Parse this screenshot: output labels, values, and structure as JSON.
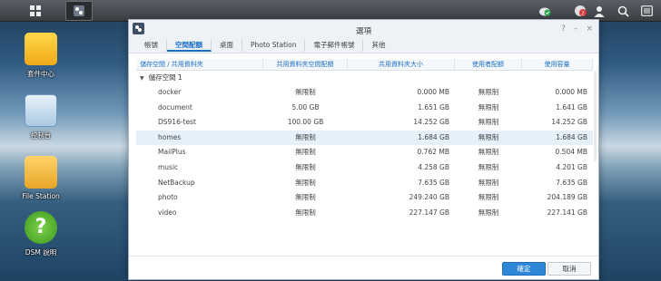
{
  "desktop": {
    "icons": [
      {
        "label": "套件中心"
      },
      {
        "label": "控制台"
      },
      {
        "label": "File Station"
      },
      {
        "label": "DSM 說明"
      }
    ]
  },
  "taskbar": {
    "notification_count": "2"
  },
  "window": {
    "title": "選項",
    "controls": {
      "help": "?",
      "minimize": "–",
      "close": "×"
    },
    "tabs": [
      {
        "label": "帳號"
      },
      {
        "label": "空間配額"
      },
      {
        "label": "桌面"
      },
      {
        "label": "Photo Station"
      },
      {
        "label": "電子郵件帳號"
      },
      {
        "label": "其他"
      }
    ],
    "active_tab": 1,
    "table": {
      "headers": [
        "儲存空間 / 共用資料夾",
        "共用資料夾空間配額",
        "共用資料夾大小",
        "使用者配額",
        "使用容量"
      ],
      "group": "儲存空間 1",
      "rows": [
        [
          "docker",
          "無限制",
          "0.000 MB",
          "無限制",
          "0.000 MB"
        ],
        [
          "document",
          "5.00 GB",
          "1.651 GB",
          "無限制",
          "1.641 GB"
        ],
        [
          "DS916-test",
          "100.00 GB",
          "14.252 GB",
          "無限制",
          "14.252 GB"
        ],
        [
          "homes",
          "無限制",
          "1.684 GB",
          "無限制",
          "1.684 GB"
        ],
        [
          "MailPlus",
          "無限制",
          "0.762 MB",
          "無限制",
          "0.504 MB"
        ],
        [
          "music",
          "無限制",
          "4.258 GB",
          "無限制",
          "4.201 GB"
        ],
        [
          "NetBackup",
          "無限制",
          "7.635 GB",
          "無限制",
          "7.635 GB"
        ],
        [
          "photo",
          "無限制",
          "249.240 GB",
          "無限制",
          "204.189 GB"
        ],
        [
          "video",
          "無限制",
          "227.147 GB",
          "無限制",
          "227.141 GB"
        ]
      ],
      "selected_row": 3
    },
    "buttons": {
      "ok": "確定",
      "cancel": "取消"
    }
  },
  "colors": {
    "accent": "#1a6ec4",
    "primary_button": "#2e86d6",
    "selected_row": "#e5f0fa"
  }
}
